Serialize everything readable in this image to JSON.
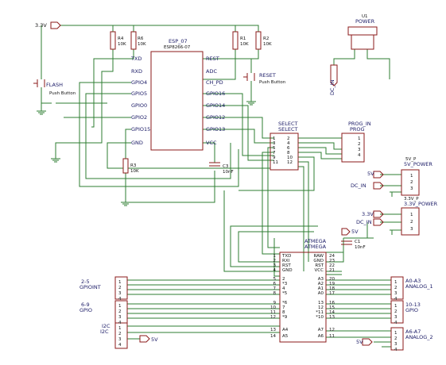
{
  "nets": {
    "v33": "3.3V",
    "v5": "5V",
    "dc_in": "DC_IN",
    "dc_in_b": "DC_IN"
  },
  "resistors": [
    {
      "ref": "R4",
      "value": "10K"
    },
    {
      "ref": "R6",
      "value": "10K"
    },
    {
      "ref": "R1",
      "value": "10K"
    },
    {
      "ref": "R2",
      "value": "10K"
    },
    {
      "ref": "R3",
      "value": "10K"
    }
  ],
  "esp": {
    "name": "ESP_07",
    "part": "ESP8266-07",
    "left_pins": [
      "TXD",
      "RXD",
      "GPIO4",
      "GPIO5",
      "GPIO0",
      "GPIO2",
      "GPIO15",
      "GND"
    ],
    "right_pins": [
      "REST",
      "ADC",
      "CH_PD",
      "GPIO16",
      "GPIO14",
      "GPIO12",
      "GPIO13",
      "VCC"
    ]
  },
  "flash": {
    "ref": "FLASH",
    "desc": "Push Button"
  },
  "reset": {
    "ref": "RESET",
    "desc": "Push Button"
  },
  "power": {
    "ref": "U1",
    "name": "POWER"
  },
  "select": {
    "ref": "SELECT",
    "name": "SELECT",
    "pins": [
      "1",
      "2",
      "3",
      "4",
      "5",
      "6",
      "7",
      "8",
      "9",
      "10",
      "11",
      "12"
    ]
  },
  "prog": {
    "ref": "PROG_IN",
    "name": "PROG",
    "pins": [
      "1",
      "2",
      "3",
      "4"
    ]
  },
  "c3": {
    "ref": "C3",
    "value": "10nF"
  },
  "c1": {
    "ref": "C1",
    "value": "10nF"
  },
  "v5_power": {
    "ref": "5V_P",
    "name": "5V_POWER",
    "pins": [
      "1",
      "2",
      "3"
    ]
  },
  "v33_power": {
    "ref": "3.3V_P",
    "name": "3.3V_POWER",
    "pins": [
      "1",
      "2",
      "3"
    ]
  },
  "atmega": {
    "ref": "ATMEGA",
    "name": "ATMEGA",
    "left_pins": [
      "TXD",
      "RXI",
      "RST",
      "GND",
      "2",
      "*3",
      "4",
      "*5",
      "*6",
      "7",
      "8",
      "*9",
      "A4",
      "A5"
    ],
    "left_nums": [
      "1",
      "2",
      "3",
      "4",
      "5",
      "6",
      "7",
      "8",
      "9",
      "10",
      "11",
      "12",
      "13",
      "14"
    ],
    "right_pins": [
      "RAW",
      "GND",
      "RST",
      "VCC",
      "A3",
      "A2",
      "A1",
      "A0",
      "13",
      "12",
      "*11",
      "*10",
      "A7",
      "A6"
    ],
    "right_nums": [
      "24",
      "23",
      "22",
      "21",
      "20",
      "19",
      "18",
      "17",
      "16",
      "15",
      "14",
      "13",
      "12",
      "11"
    ]
  },
  "j_left": [
    {
      "ref": "2-5",
      "name": "GPIOINT",
      "pins": [
        "1",
        "2",
        "3",
        "4"
      ]
    },
    {
      "ref": "6-9",
      "name": "GPIO",
      "pins": [
        "1",
        "2",
        "3",
        "4"
      ]
    },
    {
      "ref": "I2C",
      "name": "I2C",
      "pins": [
        "1",
        "2",
        "3",
        "4"
      ]
    }
  ],
  "j_right": [
    {
      "ref": "A0-A3",
      "name": "ANALOG_1",
      "pins": [
        "1",
        "2",
        "3",
        "4"
      ]
    },
    {
      "ref": "10-13",
      "name": "GPIO",
      "pins": [
        "1",
        "2",
        "3",
        "4"
      ]
    },
    {
      "ref": "A6-A7",
      "name": "ANALOG_2",
      "pins": [
        "1",
        "2",
        "3",
        "4"
      ]
    }
  ]
}
